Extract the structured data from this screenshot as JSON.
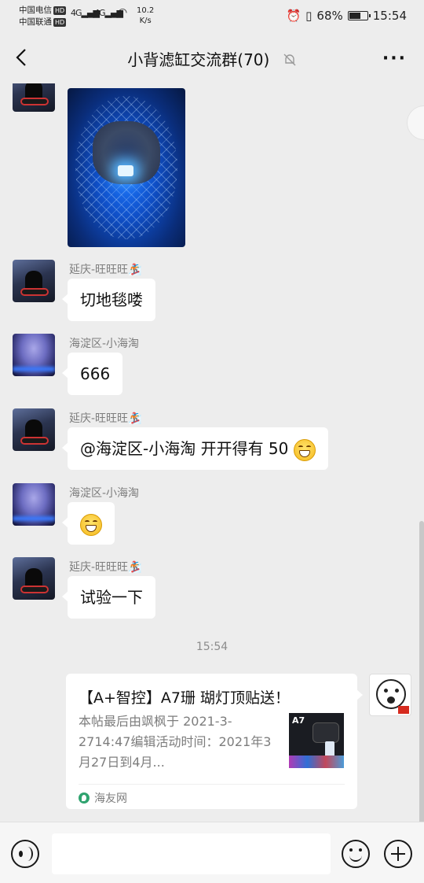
{
  "status_bar": {
    "carrier1": "中国电信",
    "carrier2": "中国联通",
    "hd": "HD",
    "network1": "4G",
    "network2": "4G",
    "speed_value": "10.2",
    "speed_unit": "K/s",
    "battery_percent": "68%",
    "battery_level": 0.68,
    "time": "15:54"
  },
  "header": {
    "title": "小背滤缸交流群(70)",
    "more": "···"
  },
  "messages": [
    {
      "type": "image",
      "sender": ""
    },
    {
      "type": "text",
      "sender": "延庆-旺旺旺🏂",
      "text": "切地毯喽"
    },
    {
      "type": "text",
      "sender": "海淀区-小海淘",
      "text": "666"
    },
    {
      "type": "text",
      "sender": "延庆-旺旺旺🏂",
      "text": "@海淀区-小海淘  开开得有 50"
    },
    {
      "type": "emoji",
      "sender": "海淀区-小海淘"
    },
    {
      "type": "text",
      "sender": "延庆-旺旺旺🏂",
      "text": "试验一下"
    }
  ],
  "timestamp": "15:54",
  "link_card": {
    "title": "【A+智控】A7珊 瑚灯顶贴送！",
    "description": "本帖最后由飒枫于 2021-3-2714:47编辑活动时间：2021年3月27日到4月...",
    "thumb_label": "A7",
    "source": "海友网"
  },
  "input": {
    "placeholder": ""
  }
}
